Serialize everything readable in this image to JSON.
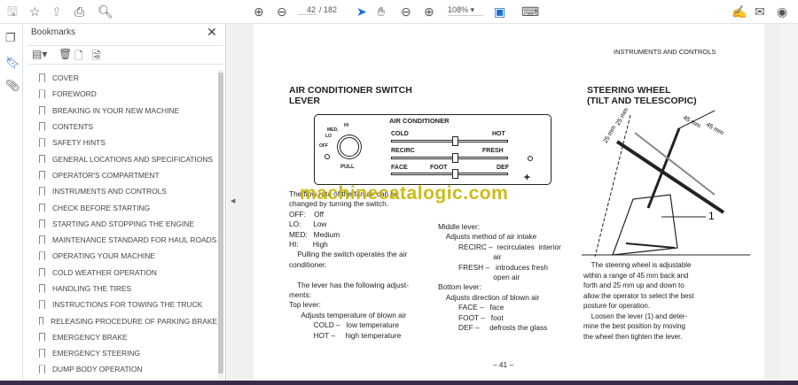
{
  "toolbar": {
    "page_current": "42",
    "page_total": "/ 182",
    "zoom": "108%"
  },
  "bookmarks": {
    "title": "Bookmarks",
    "items": [
      "COVER",
      "FOREWORD",
      "BREAKING IN YOUR NEW MACHINE",
      "CONTENTS",
      "SAFETY HINTS",
      "GENERAL LOCATIONS AND SPECIFICATIONS",
      "OPERATOR'S COMPARTMENT",
      "INSTRUMENTS AND CONTROLS",
      "CHECK BEFORE STARTING",
      "STARTING AND STOPPING THE ENGINE",
      "MAINTENANCE STANDARD FOR HAUL ROADS",
      "OPERATING YOUR MACHINE",
      "COLD WEATHER OPERATION",
      "HANDLING THE TIRES",
      "INSTRUCTIONS FOR TOWING THE TRUCK",
      "RELEASING PROCEDURE OF PARKING BRAKE",
      "EMERGENCY BRAKE",
      "EMERGENCY STEERING",
      "DUMP BODY OPERATION"
    ]
  },
  "page": {
    "header": "INSTRUMENTS AND CONTROLS",
    "left_title_1": "AIR CONDITIONER SWITCH",
    "left_title_2": "LEVER",
    "ac": {
      "title": "AIR CONDITIONER",
      "hi": "HI",
      "med": "MED.",
      "lo": "LO",
      "off": "OFF",
      "pull": "PULL",
      "cold": "COLD",
      "hot": "HOT",
      "recirc": "RECIRC",
      "fresh": "FRESH",
      "face": "FACE",
      "foot": "FOOT",
      "def": "DEF"
    },
    "watermark": "machinecatalogic.com",
    "left_lines": [
      "The flow rate of the fan air can be",
      "changed by turning the switch.",
      "OFF:    Off",
      "LO:      Low",
      "MED:   Medium",
      "HI:       High",
      "    Pulling the switch operates the air",
      "conditioner.",
      "",
      "    The lever has the following adjust-",
      "ments:",
      "Top lever:",
      "      Adjusts temperature of blown air",
      "            COLD –   low temperature",
      "            HOT –     high temperature"
    ],
    "mid_lines": [
      "Middle lever:",
      "    Adjusts method of air intake",
      "          RECIRC –  recirculates  interior",
      "                           air",
      "          FRESH –   introduces fresh",
      "                           open air",
      "Bottom lever:",
      "    Adjusts direction of blown air",
      "          FACE –   face",
      "          FOOT –   foot",
      "          DEF –     defrosts the glass"
    ],
    "right_title_1": "STEERING WHEEL",
    "right_title_2": "(TILT AND TELESCOPIC)",
    "fig": {
      "d1": "45 mm",
      "d2": "45 mm",
      "d3": "25 mm",
      "d4": "25 mm",
      "callout": "1"
    },
    "right_lines": [
      "    The steering wheel is adjustable",
      "within a range of 45 mm back and",
      "forth and 25 mm up and down to",
      "allow the operator to select the best",
      "posture for operation.",
      "    Loosen the lever (1) and deter-",
      "mine the best position by moving",
      "the wheel then tighten the lever."
    ],
    "page_number": "– 41 –"
  }
}
